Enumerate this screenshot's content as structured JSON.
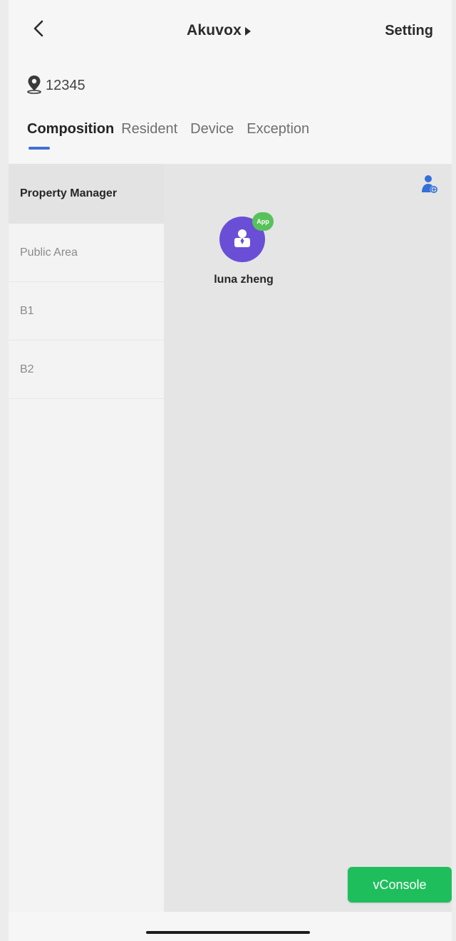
{
  "header": {
    "title": "Akuvox",
    "setting_label": "Setting"
  },
  "location": {
    "code": "12345"
  },
  "tabs": [
    {
      "label": "Composition",
      "active": true
    },
    {
      "label": "Resident",
      "active": false
    },
    {
      "label": "Device",
      "active": false
    },
    {
      "label": "Exception",
      "active": false
    }
  ],
  "sidebar": {
    "items": [
      {
        "label": "Property Manager",
        "active": true
      },
      {
        "label": "Public Area",
        "active": false
      },
      {
        "label": "B1",
        "active": false
      },
      {
        "label": "B2",
        "active": false
      }
    ]
  },
  "members": [
    {
      "name": "luna zheng",
      "badge": "App"
    }
  ],
  "icons": {
    "back": "chevron-left-icon",
    "location": "location-pin-icon",
    "add_user": "add-user-icon",
    "member_avatar": "person-icon"
  },
  "colors": {
    "accent": "#3f6fd8",
    "avatar": "#6a4fd6",
    "badge": "#58c25a",
    "vconsole": "#1fbe5d"
  },
  "debug": {
    "vconsole_label": "vConsole"
  }
}
